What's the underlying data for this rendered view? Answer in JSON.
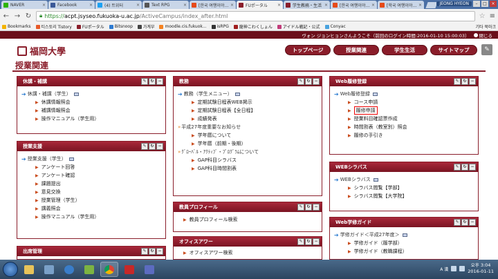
{
  "browser": {
    "tabs": [
      {
        "label": "NAVER",
        "color": "#2db400",
        "active": false
      },
      {
        "label": "Facebook",
        "color": "#3b5998",
        "active": false
      },
      {
        "label": "(4) 트위터",
        "color": "#1da1f2",
        "active": false
      },
      {
        "label": "Text RPG",
        "color": "#555555",
        "active": false
      },
      {
        "label": "[한국 여행이야기]",
        "color": "#e64a19",
        "active": false
      },
      {
        "label": "FUポータル",
        "color": "#8a1d2a",
        "active": true
      },
      {
        "label": "学生教務・生活",
        "color": "#8a1d2a",
        "active": false
      },
      {
        "label": "[한국 여행이야기]",
        "color": "#e64a19",
        "active": false
      },
      {
        "label": "[학국 여행이야기]",
        "color": "#e64a19",
        "active": false
      }
    ],
    "window_user": "JEONG HYEON",
    "url": {
      "scheme": "https://",
      "host": "acpt.jsyseo.fukuoka-u.ac.jp",
      "path": "/ActiveCampus/index_after.html"
    },
    "bookmarks": [
      {
        "label": "Bookmarks",
        "color": "#f4b400"
      },
      {
        "label": "티스토리 Tistory",
        "color": "#e85a28"
      },
      {
        "label": "FUポータル",
        "color": "#8a1d2a"
      },
      {
        "label": "Bitsnoop",
        "color": "#2e7bd1"
      },
      {
        "label": "가계부",
        "color": "#444444"
      },
      {
        "label": "moodle.cis.fukuok...",
        "color": "#f58220"
      },
      {
        "label": "isRPG",
        "color": "#333333"
      },
      {
        "label": "龍神こわくしょん",
        "color": "#a01e1e"
      },
      {
        "label": "アイドル戦記・公式",
        "color": "#c23b7a"
      },
      {
        "label": "Conyac",
        "color": "#4aa3df"
      }
    ],
    "other_bookmarks": "기타 북마크"
  },
  "portal": {
    "welcome": "ヴォン ジョンヒョンさんようこそ（前回のログイン時間:2016-01-10 15:00:03）",
    "logout": "閉じる",
    "logo_text": "福岡大學",
    "nav": [
      "トップページ",
      "授業関連",
      "学生生活",
      "サイトマップ"
    ],
    "page_title": "授業関連"
  },
  "portlets": {
    "kyuko": {
      "title": "休講・補講",
      "section": "休講・補講（学生）",
      "items": [
        "休講情報照会",
        "補講情報照会",
        "操作マニュアル（学生用）"
      ]
    },
    "shien": {
      "title": "授業支援",
      "section": "授業支援（学生）",
      "items": [
        "アンケート回答",
        "アンケート確認",
        "課題提出",
        "意見交換",
        "授業管理（学生）",
        "講義照会",
        "操作マニュアル（学生用）"
      ]
    },
    "shusseki": {
      "title": "出席管理"
    },
    "kyomu": {
      "title": "教務",
      "section": "教務（学生メニュー）",
      "items1": [
        "定期試験日程表WEB掲示",
        "定期試験日程表【全日程】",
        "成績発表"
      ],
      "section2": "平成27年度重要なお知らせ",
      "items2": [
        "学年暦について",
        "学年暦（前期・後期）"
      ],
      "section3": "ｸﾞﾛｰﾊﾞﾙ・ｱｸﾃｨﾌﾞ・ﾌﾟﾛｸﾞﾗﾑについて",
      "items3": [
        "GAP科目シラバス",
        "GAP科目時間割表"
      ]
    },
    "profile": {
      "title": "教員プロフィール",
      "items": [
        "教員プロフィール検索"
      ]
    },
    "office": {
      "title": "オフィスアワー",
      "items": [
        "オフィスアワー検索"
      ]
    },
    "rishu": {
      "title": "Web履修登録",
      "section": "Web履修登録",
      "items": [
        "コース申請",
        "履修申請",
        "授業料目確認票作成",
        "時間割表（教室別）照会",
        "履修の手引き"
      ],
      "highlight": "履修申請"
    },
    "syllabus": {
      "title": "WEBシラバス",
      "section": "WEBシラバス",
      "items": [
        "シラバス閲覧【学部】",
        "シラバス閲覧【大学院】"
      ]
    },
    "guide": {
      "title": "Web学修ガイド",
      "section": "学修ガイド＜平成27年度＞",
      "items": [
        "学修ガイド（履学部）",
        "学修ガイド（教職課程）"
      ]
    }
  },
  "taskbar": {
    "time": "오후 3:04",
    "date": "2016-01-11",
    "ime": "A 漢"
  },
  "colors": {
    "brand": "#8a1d2a",
    "brand_dark": "#6b0f1a",
    "bullet": "#c94b1c",
    "link_arrow": "#2a7bd0",
    "highlight_box": "#ee0000"
  }
}
